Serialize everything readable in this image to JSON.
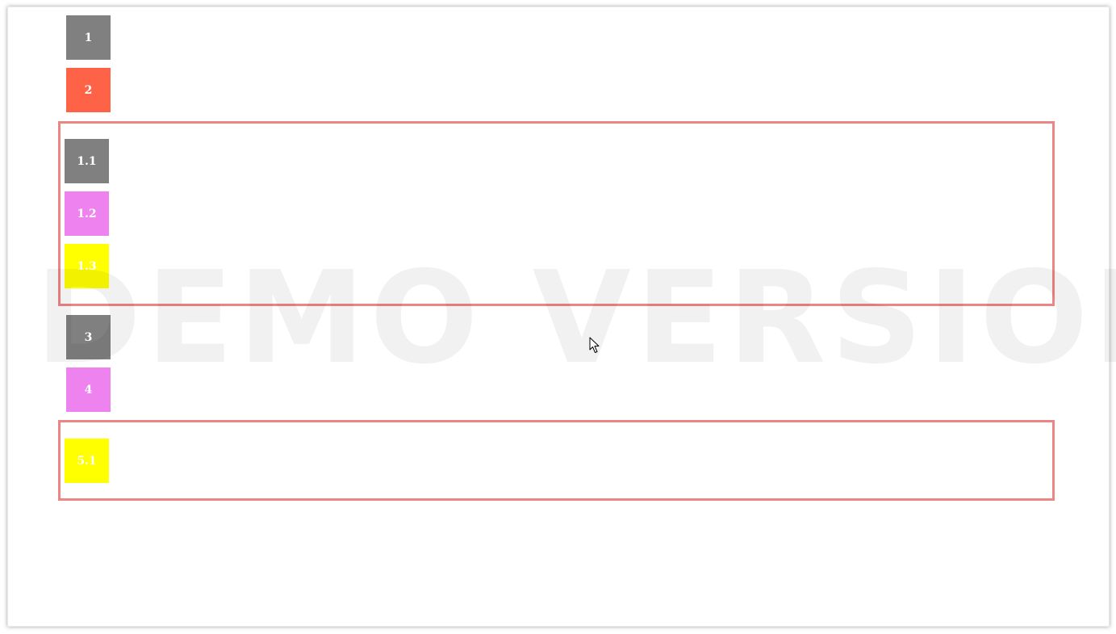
{
  "watermark": "DEMO VERSION",
  "colors": {
    "gray": "#808080",
    "tomato": "#ff6347",
    "violet": "#ee82ee",
    "yellow": "#ffff00",
    "group_border": "#ee8585"
  },
  "items": {
    "item_1": "1",
    "item_2": "2",
    "group_1": {
      "item_1_1": "1.1",
      "item_1_2": "1.2",
      "item_1_3": "1.3"
    },
    "item_3": "3",
    "item_4": "4",
    "group_5": {
      "item_5_1": "5.1"
    }
  },
  "cursor": "arrow-cursor-icon"
}
